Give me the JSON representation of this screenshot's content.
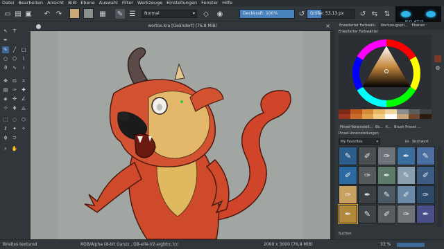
{
  "menu": [
    "Datei",
    "Bearbeiten",
    "Ansicht",
    "Bild",
    "Ebene",
    "Auswahl",
    "Filter",
    "Werkzeuge",
    "Einstellungen",
    "Fenster",
    "Hilfe"
  ],
  "toolbar": {
    "blend_mode": "Normal",
    "opacity_label": "Deckkraft: 100%",
    "opacity_value": 1.0,
    "size_label": "Größe: 53,13 px",
    "size_value": 0.3,
    "logo_text": "NYLATIS"
  },
  "document": {
    "tab_title": "wortox.kra [Geändert] (76,8 MiB)"
  },
  "docker": {
    "tabs": [
      "Erweiterter Farbwähl.",
      "Werkzeugopti...",
      "Ebenen"
    ],
    "selector_title": "Erweiterter Farbwähler",
    "sub_tabs": [
      "Pinsel-Voreinstell...",
      "Eb...",
      "K...",
      "Brush Preset ..."
    ],
    "presets_title": "Pinsel-Voreinstellungen",
    "tag": "My Favorites",
    "tag_label": "Stichwort",
    "search_placeholder": "Suchen",
    "history_colors": [
      [
        "#7a2a14",
        "#b9571c",
        "#d38936",
        "#e8b864",
        "#f1d79d",
        "#8a8e8c",
        "#5b5e5c",
        "#3f4244"
      ],
      [
        "#9b3520",
        "#c86b2a",
        "#e0a04a",
        "#f3cf86",
        "#ffffff",
        "#c9a47a",
        "#74462b",
        "#2c1a10"
      ]
    ]
  },
  "status": {
    "brush": "Bristles textured",
    "color_space": "RGB/Alpha (8-bit Ganzz...GB-elle-V2-srgbtrc.icc",
    "dimensions": "2000 x 3000 (76,8 MiB)",
    "zoom": "33 %"
  },
  "colors": {
    "accent": "#3d6a9a",
    "fg_swatch": "#c8a878",
    "bg_swatch": "#8a8e8c",
    "canvas_bg": "#9ba09d"
  }
}
